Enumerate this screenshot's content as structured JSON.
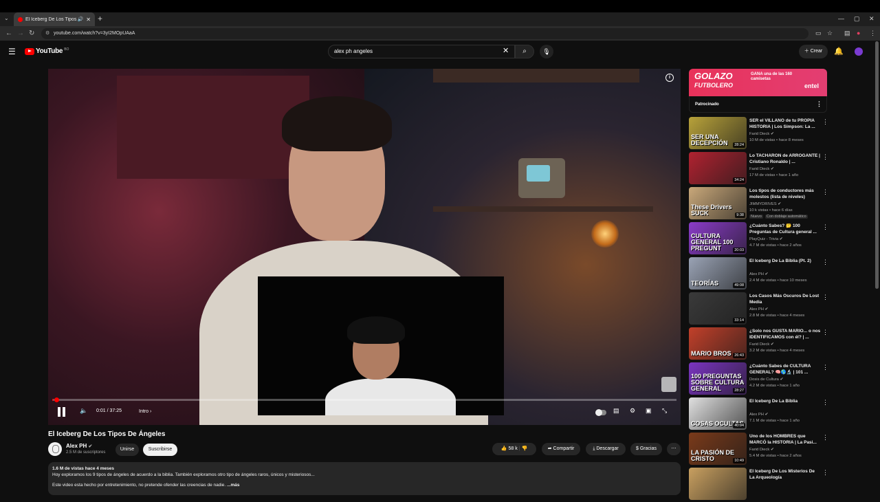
{
  "browser": {
    "tab_title": "El Iceberg De Los Tipos De",
    "url": "youtube.com/watch?v=3yI2MOpUAaA"
  },
  "header": {
    "logo_text": "YouTube",
    "logo_country": "BO",
    "search_value": "alex ph angeles",
    "create_label": "Crear"
  },
  "player": {
    "time": "0:01 / 37:25",
    "chapter": "Intro",
    "progress_fraction": 0.0004
  },
  "video": {
    "title": "El Iceberg De Los Tipos De Ángeles",
    "channel": "Alex PH",
    "subscribers": "2.5 M de suscriptores",
    "join_label": "Unirse",
    "subscribe_label": "Suscribirse",
    "likes": "58 k",
    "share_label": "Compartir",
    "download_label": "Descargar",
    "thanks_label": "Gracias"
  },
  "description": {
    "meta": "1.6 M de vistas  hace 4 meses",
    "line1": "Hoy exploramos los 9 tipos de ángeles de acuerdo a la biblia. También exploramos otro tipo de ángeles raros, únicos y misteriosos...",
    "line2": "Este video esta hecho por entretenimiento, no pretende ofender las creencias de nadie.",
    "more": "...más"
  },
  "ad": {
    "headline1": "GOLAZO",
    "headline2": "FUTBOLERO",
    "sub": "GANA una de las 160 camisetas",
    "brand": "entel",
    "sponsored": "Patrocinado"
  },
  "recommendations": [
    {
      "title": "SER el VILLANO de tu PROPIA HISTORIA | Los Simpson: La ...",
      "channel": "Farid Dieck",
      "stats": "10 M de vistas • hace 8 meses",
      "duration": "28:24",
      "thumb_text": "SER UNA DECEPCIÓN",
      "color": "#b8a23a"
    },
    {
      "title": "Lo TACHARON de ARROGANTE | Cristiano Ronaldo | ...",
      "channel": "Farid Dieck",
      "stats": "17 M de vistas • hace 1 año",
      "duration": "34:24",
      "thumb_text": "",
      "color": "#b02230"
    },
    {
      "title": "Los tipos de conductores más molestos (lista de niveles)",
      "channel": "JIMMYDRIVES",
      "stats": "10 k vistas • hace 6 días",
      "duration": "9:38",
      "thumb_text": "These Drivers SUCK",
      "color": "#c9a87a",
      "badges": [
        "Nuevo",
        "Con doblaje automático"
      ]
    },
    {
      "title": "¿Cuánto Sabes? 🤔 100 Preguntas de Cultura general ...",
      "channel": "PlayQuiz - Trivia",
      "stats": "4.7 M de vistas • hace 2 años",
      "duration": "20:03",
      "thumb_text": "CULTURA GENERAL 100 PREGUNT",
      "color": "#8a3bc8"
    },
    {
      "title": "El Iceberg De La Biblia (Pt. 2)",
      "channel": "Alex PH",
      "stats": "2.4 M de vistas • hace 10 meses",
      "duration": "49:08",
      "thumb_text": "TEORÍAS",
      "color": "#9aa3b5"
    },
    {
      "title": "Los Casos Más Oscuros De Lost Media",
      "channel": "Alex PH",
      "stats": "2.8 M de vistas • hace 4 meses",
      "duration": "33:14",
      "thumb_text": "",
      "color": "#3a3a3a"
    },
    {
      "title": "¿Solo nos GUSTA MARIO... o nos IDENTIFICAMOS con él? | ...",
      "channel": "Farid Dieck",
      "stats": "3.2 M de vistas • hace 4 meses",
      "duration": "26:43",
      "thumb_text": "MARIO BROS",
      "color": "#c2402a"
    },
    {
      "title": "¿Cuánto Sabes de CULTURA GENERAL? 🧠🌎🔬 | 101 ...",
      "channel": "Dosis de Cultura",
      "stats": "4.2 M de vistas • hace 1 año",
      "duration": "28:27",
      "thumb_text": "100 PREGUNTAS SOBRE CULTURA GENERAL",
      "color": "#7a34c0"
    },
    {
      "title": "El Iceberg De La Biblia",
      "channel": "Alex PH",
      "stats": "7.1 M de vistas • hace 1 año",
      "duration": "40:04",
      "thumb_text": "COSAS OCULTAS",
      "color": "#e0e0e0"
    },
    {
      "title": "Uno de los HOMBRES que MARCÓ la HISTORIA | La Pasi...",
      "channel": "Farid Dieck",
      "stats": "5.4 M de vistas • hace 2 años",
      "duration": "10:49",
      "thumb_text": "LA PASIÓN DE CRISTO",
      "color": "#7a3a1a"
    },
    {
      "title": "El Iceberg De Los Misterios De La Arqueología",
      "channel": "",
      "stats": "",
      "duration": "",
      "thumb_text": "",
      "color": "#c9a060"
    }
  ]
}
